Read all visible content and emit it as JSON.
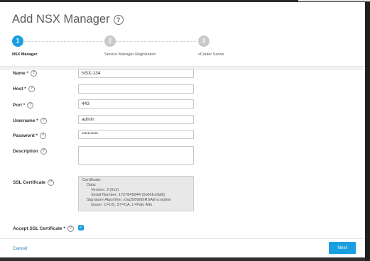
{
  "dialog": {
    "title": "Add NSX Manager",
    "help_icon": "help-circle-icon"
  },
  "steps": [
    {
      "number": "1",
      "label": "NSX Manager",
      "state": "active"
    },
    {
      "number": "2",
      "label": "Service Manager Registration",
      "state": "inactive"
    },
    {
      "number": "3",
      "label": "vCenter Server",
      "state": "inactive"
    }
  ],
  "form": {
    "name": {
      "label": "Name *",
      "value": "NSX-134"
    },
    "host": {
      "label": "Host *",
      "value": ""
    },
    "port": {
      "label": "Port *",
      "value": "443"
    },
    "username": {
      "label": "Username *",
      "value": "admin"
    },
    "password": {
      "label": "Password *",
      "value": "•••••••••••"
    },
    "description": {
      "label": "Description",
      "value": ""
    },
    "ssl_certificate": {
      "label": "SSL Certificate",
      "lines": [
        "Certificate:",
        "Data:",
        "Version: 3 (0x2)",
        "Serial Number: 1727849944 (0x66fce5d8)",
        "Signature Algorithm: sha256WithRSAEncryption",
        "Issuer: C=US, ST=CA, L=Palo Alto"
      ]
    },
    "accept_ssl": {
      "label": "Accept SSL Certificate *",
      "checked": true
    }
  },
  "footer": {
    "cancel_label": "Cancel",
    "next_label": "Next"
  },
  "colors": {
    "accent": "#1a9ee0",
    "inactive_step": "#c9c9c9"
  }
}
